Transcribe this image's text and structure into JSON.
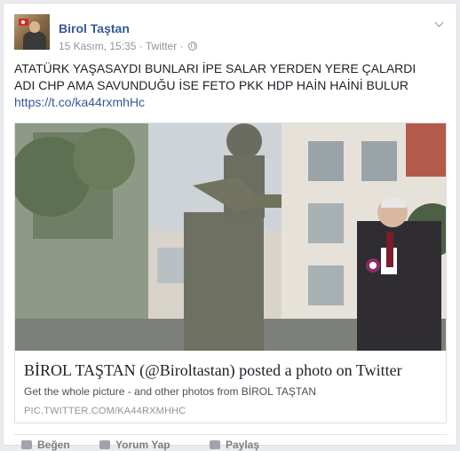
{
  "post": {
    "author": "Birol Taştan",
    "date": "15 Kasım, 15:35",
    "separator1": "·",
    "source": "Twitter",
    "separator2": "·",
    "text_before_link": "ATATÜRK YAŞASAYDI BUNLARI İPE SALAR YERDEN YERE ÇALARDI ADI CHP AMA SAVUNDUĞU İSE FETO PKK HDP HAİN HAİNİ BULUR ",
    "link_text": "https://t.co/ka44rxmhHc"
  },
  "card": {
    "title": "BİROL TAŞTAN (@Biroltastan) posted a photo on Twitter",
    "description": "Get the whole picture - and other photos from BİROL TAŞTAN",
    "domain": "PIC.TWITTER.COM/KA44RXMHHC"
  },
  "actions": {
    "like": "Beğen",
    "comment": "Yorum Yap",
    "share": "Paylaş"
  },
  "colors": {
    "link": "#365899",
    "meta": "#90949c",
    "text": "#1d2129"
  }
}
